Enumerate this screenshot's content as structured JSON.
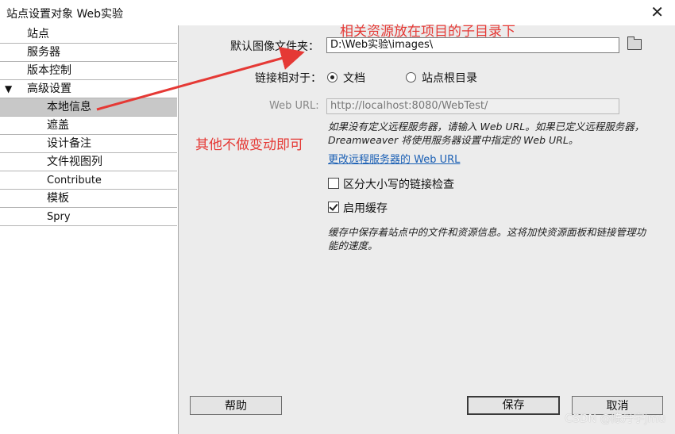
{
  "window": {
    "title": "站点设置对象 Web实验",
    "close_glyph": "✕"
  },
  "sidebar": {
    "items": [
      {
        "label": "站点"
      },
      {
        "label": "服务器"
      },
      {
        "label": "版本控制"
      },
      {
        "label": "高级设置",
        "caret": "▼"
      },
      {
        "label": "本地信息",
        "selected": true
      },
      {
        "label": "遮盖"
      },
      {
        "label": "设计备注"
      },
      {
        "label": "文件视图列"
      },
      {
        "label": "Contribute"
      },
      {
        "label": "模板"
      },
      {
        "label": "Spry"
      }
    ]
  },
  "form": {
    "image_folder_label": "默认图像文件夹：",
    "image_folder_value": "D:\\Web实验\\images\\",
    "link_relative_label": "链接相对于：",
    "radio_document": "文档",
    "radio_site_root": "站点根目录",
    "link_relative_selected": "文档",
    "web_url_label": "Web URL:",
    "web_url_value": "http://localhost:8080/WebTest/",
    "web_url_note": "如果没有定义远程服务器，请输入 Web URL。如果已定义远程服务器，Dreamweaver 将使用服务器设置中指定的 Web URL。",
    "change_server_link": "更改远程服务器的 Web URL",
    "case_sensitive_label": "区分大小写的链接检查",
    "case_sensitive_checked": false,
    "enable_cache_label": "启用缓存",
    "enable_cache_checked": true,
    "cache_note": "缓存中保存着站点中的文件和资源信息。这将加快资源面板和链接管理功能的速度。"
  },
  "buttons": {
    "help": "帮助",
    "save": "保存",
    "cancel": "取消"
  },
  "annotations": {
    "top": "相关资源放在项目的子目录下",
    "left": "其他不做变动即可",
    "color": "#e53935"
  },
  "watermark": "CSDN @陈丹宇jmu",
  "icons": {
    "folder": "folder-icon",
    "close": "close-icon",
    "caret": "caret-down-icon"
  }
}
